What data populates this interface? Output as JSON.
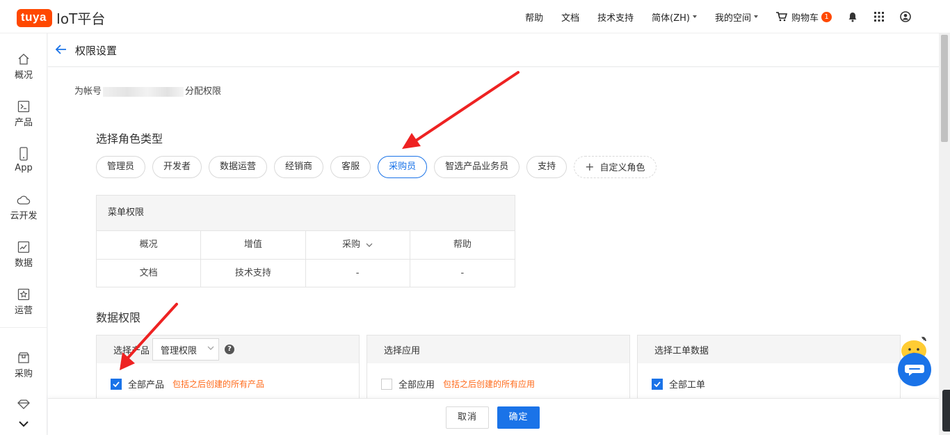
{
  "app": {
    "logo_badge": "tuya",
    "logo_text": "IoT平台"
  },
  "topnav": {
    "help": "帮助",
    "docs": "文档",
    "tech_support": "技术支持",
    "language": "简体(ZH)",
    "my_space": "我的空间",
    "cart": "购物车",
    "cart_count": "1"
  },
  "sidebar": {
    "items": [
      {
        "label": "概况",
        "icon": "home-icon"
      },
      {
        "label": "产品",
        "icon": "terminal-icon"
      },
      {
        "label": "App",
        "icon": "phone-icon"
      },
      {
        "label": "云开发",
        "icon": "cloud-icon"
      },
      {
        "label": "数据",
        "icon": "chart-icon"
      },
      {
        "label": "运营",
        "icon": "star-icon"
      },
      {
        "label": "采购",
        "icon": "box-icon"
      }
    ]
  },
  "page": {
    "title": "权限设置",
    "assign_prefix": "为帐号",
    "assign_suffix": "分配权限"
  },
  "roles": {
    "section_title": "选择角色类型",
    "items": [
      "管理员",
      "开发者",
      "数据运营",
      "经销商",
      "客服",
      "采购员",
      "智选产品业务员",
      "支持"
    ],
    "active": "采购员",
    "custom_label": "自定义角色"
  },
  "menu_permissions": {
    "header": "菜单权限",
    "rows": [
      [
        "概况",
        "增值",
        "采购",
        "帮助"
      ],
      [
        "文档",
        "技术支持",
        "-",
        "-"
      ]
    ]
  },
  "data_permissions": {
    "section_title": "数据权限",
    "boxes": [
      {
        "header": "选择产品",
        "select_value": "管理权限",
        "option": "全部产品",
        "hint": "包括之后创建的所有产品",
        "checked": true
      },
      {
        "header": "选择应用",
        "option": "全部应用",
        "hint": "包括之后创建的所有应用",
        "checked": false
      },
      {
        "header": "选择工单数据",
        "option": "全部工单",
        "hint": "",
        "checked": true
      }
    ]
  },
  "footer": {
    "cancel": "取消",
    "confirm": "确定"
  },
  "colors": {
    "brand": "#ff4800",
    "primary": "#1a73e8",
    "hint": "#ff6a1a",
    "annotation_arrow": "#ee2222"
  }
}
